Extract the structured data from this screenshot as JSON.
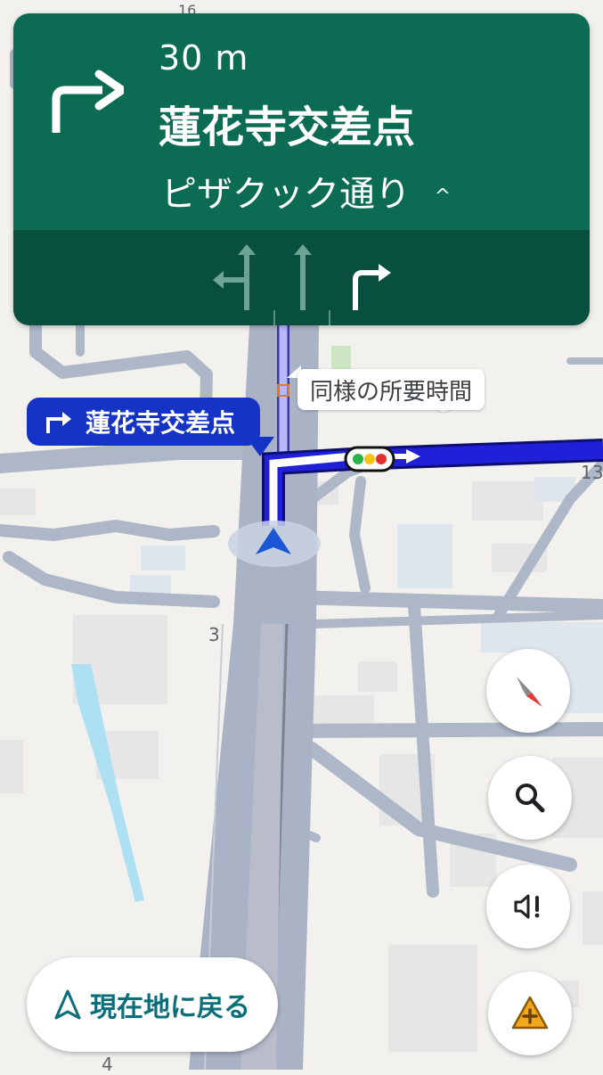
{
  "navigation": {
    "distance": "30 m",
    "street": "蓮花寺交差点",
    "towards": "ピザクック通り",
    "towards_chevron": "^",
    "maneuver_icon": "turn-right-icon",
    "lanes": [
      {
        "icon": "lane-straight-left-icon",
        "active": false
      },
      {
        "icon": "lane-straight-icon",
        "active": false
      },
      {
        "icon": "lane-right-icon",
        "active": true
      }
    ],
    "card_color": "#0c6b53",
    "lane_bar_color": "#084f3e"
  },
  "map": {
    "turn_callout": "蓮花寺交差点",
    "alt_route_label": "同様の所要時間",
    "road_numbers": [
      "16",
      "13",
      "3",
      "4"
    ],
    "route_color": "#1a1ad0"
  },
  "controls": {
    "compass_icon": "compass-icon",
    "search_icon": "search-icon",
    "sound_icon": "sound-alert-icon",
    "report_icon": "report-incident-icon",
    "recenter_label": "現在地に戻る"
  }
}
